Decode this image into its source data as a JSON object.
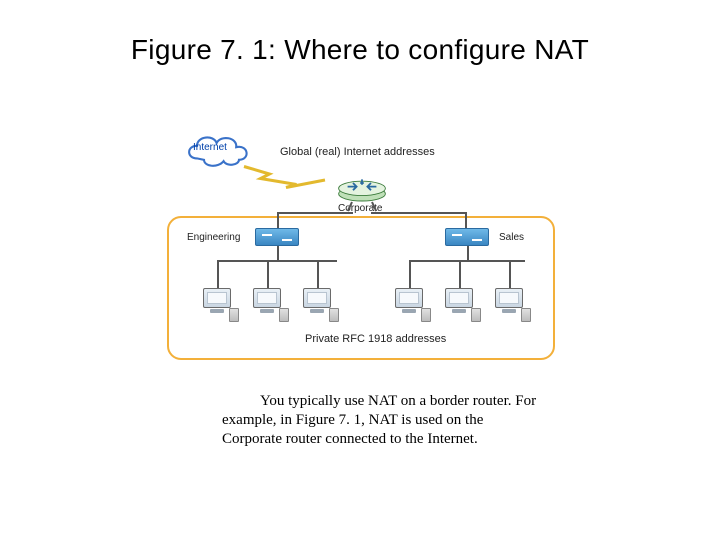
{
  "title": "Figure 7. 1: Where to configure NAT",
  "diagram": {
    "cloud_label": "Internet",
    "global_addresses_label": "Global (real) Internet addresses",
    "corporate_router_label": "Corporate",
    "engineering_label": "Engineering",
    "sales_label": "Sales",
    "private_addresses_label": "Private RFC 1918 addresses"
  },
  "caption": {
    "text_line1": "You typically use NAT on a border router. For",
    "text_line2": "example, in Figure 7. 1, NAT is used on the",
    "text_line3": "Corporate router connected to the Internet."
  }
}
